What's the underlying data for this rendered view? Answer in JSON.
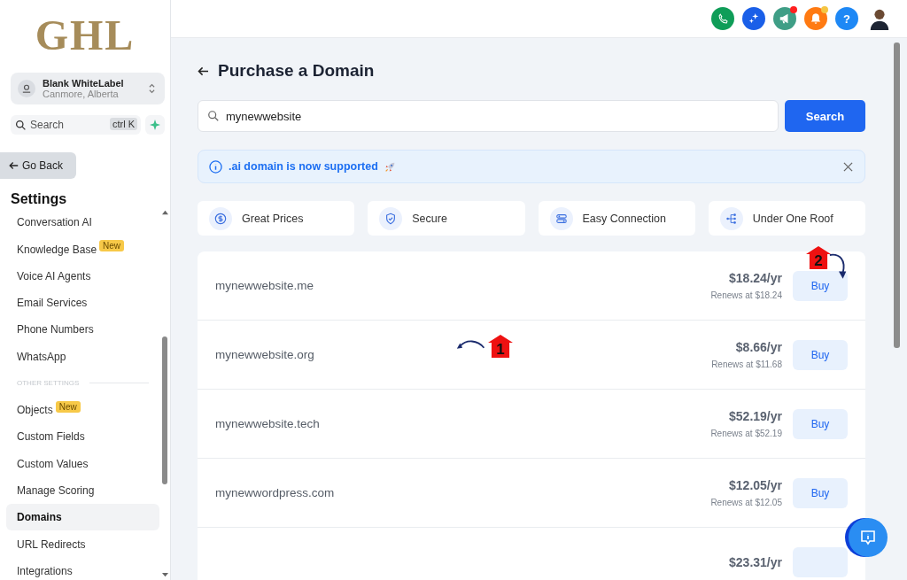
{
  "sidebar": {
    "logo": "GHL",
    "account": {
      "name": "Blank WhiteLabel",
      "location": "Canmore, Alberta"
    },
    "search": {
      "placeholder": "Search",
      "shortcut": "ctrl K"
    },
    "back_button": "Go Back",
    "heading": "Settings",
    "items": [
      {
        "kind": "item",
        "label": "Conversation AI",
        "selected": false
      },
      {
        "kind": "item",
        "label": "Knowledge Base",
        "badge": "New",
        "selected": false
      },
      {
        "kind": "item",
        "label": "Voice AI Agents",
        "selected": false
      },
      {
        "kind": "item",
        "label": "Email Services",
        "selected": false
      },
      {
        "kind": "item",
        "label": "Phone Numbers",
        "selected": false
      },
      {
        "kind": "item",
        "label": "WhatsApp",
        "selected": false
      },
      {
        "kind": "section",
        "label": "OTHER SETTINGS"
      },
      {
        "kind": "item",
        "label": "Objects",
        "badge": "New",
        "selected": false
      },
      {
        "kind": "item",
        "label": "Custom Fields",
        "selected": false
      },
      {
        "kind": "item",
        "label": "Custom Values",
        "selected": false
      },
      {
        "kind": "item",
        "label": "Manage Scoring",
        "selected": false
      },
      {
        "kind": "item",
        "label": "Domains",
        "selected": true
      },
      {
        "kind": "item",
        "label": "URL Redirects",
        "selected": false
      },
      {
        "kind": "item",
        "label": "Integrations",
        "selected": false
      }
    ]
  },
  "header": {
    "icons": [
      {
        "kind": "phone"
      },
      {
        "kind": "sparkle"
      },
      {
        "kind": "megaphone",
        "color": "#ff1f1f"
      },
      {
        "kind": "bell",
        "color": "#f5c542"
      },
      {
        "kind": "help",
        "label": "?"
      },
      {
        "kind": "avatar"
      }
    ]
  },
  "page": {
    "title": "Purchase a Domain",
    "search": {
      "value": "mynewwebsite",
      "button": "Search"
    },
    "banner": {
      "text": ".ai domain is now supported"
    },
    "features": [
      {
        "kind": "price",
        "label": "Great Prices"
      },
      {
        "kind": "secure",
        "label": "Secure"
      },
      {
        "kind": "connection",
        "label": "Easy Connection"
      },
      {
        "kind": "roof",
        "label": "Under One Roof"
      }
    ],
    "domains": [
      {
        "name": "mynewwebsite.me",
        "price": "$18.24/yr",
        "renews": "Renews at $18.24",
        "button": "Buy",
        "marker": {
          "label": "2",
          "kind": "down"
        }
      },
      {
        "name": "mynewwebsite.org",
        "price": "$8.66/yr",
        "renews": "Renews at $11.68",
        "button": "Buy",
        "marker": {
          "label": "1",
          "kind": "left"
        }
      },
      {
        "name": "mynewwebsite.tech",
        "price": "$52.19/yr",
        "renews": "Renews at $52.19",
        "button": "Buy"
      },
      {
        "name": "mynewwordpress.com",
        "price": "$12.05/yr",
        "renews": "Renews at $12.05",
        "button": "Buy"
      },
      {
        "price": "$23.31/yr"
      }
    ]
  }
}
